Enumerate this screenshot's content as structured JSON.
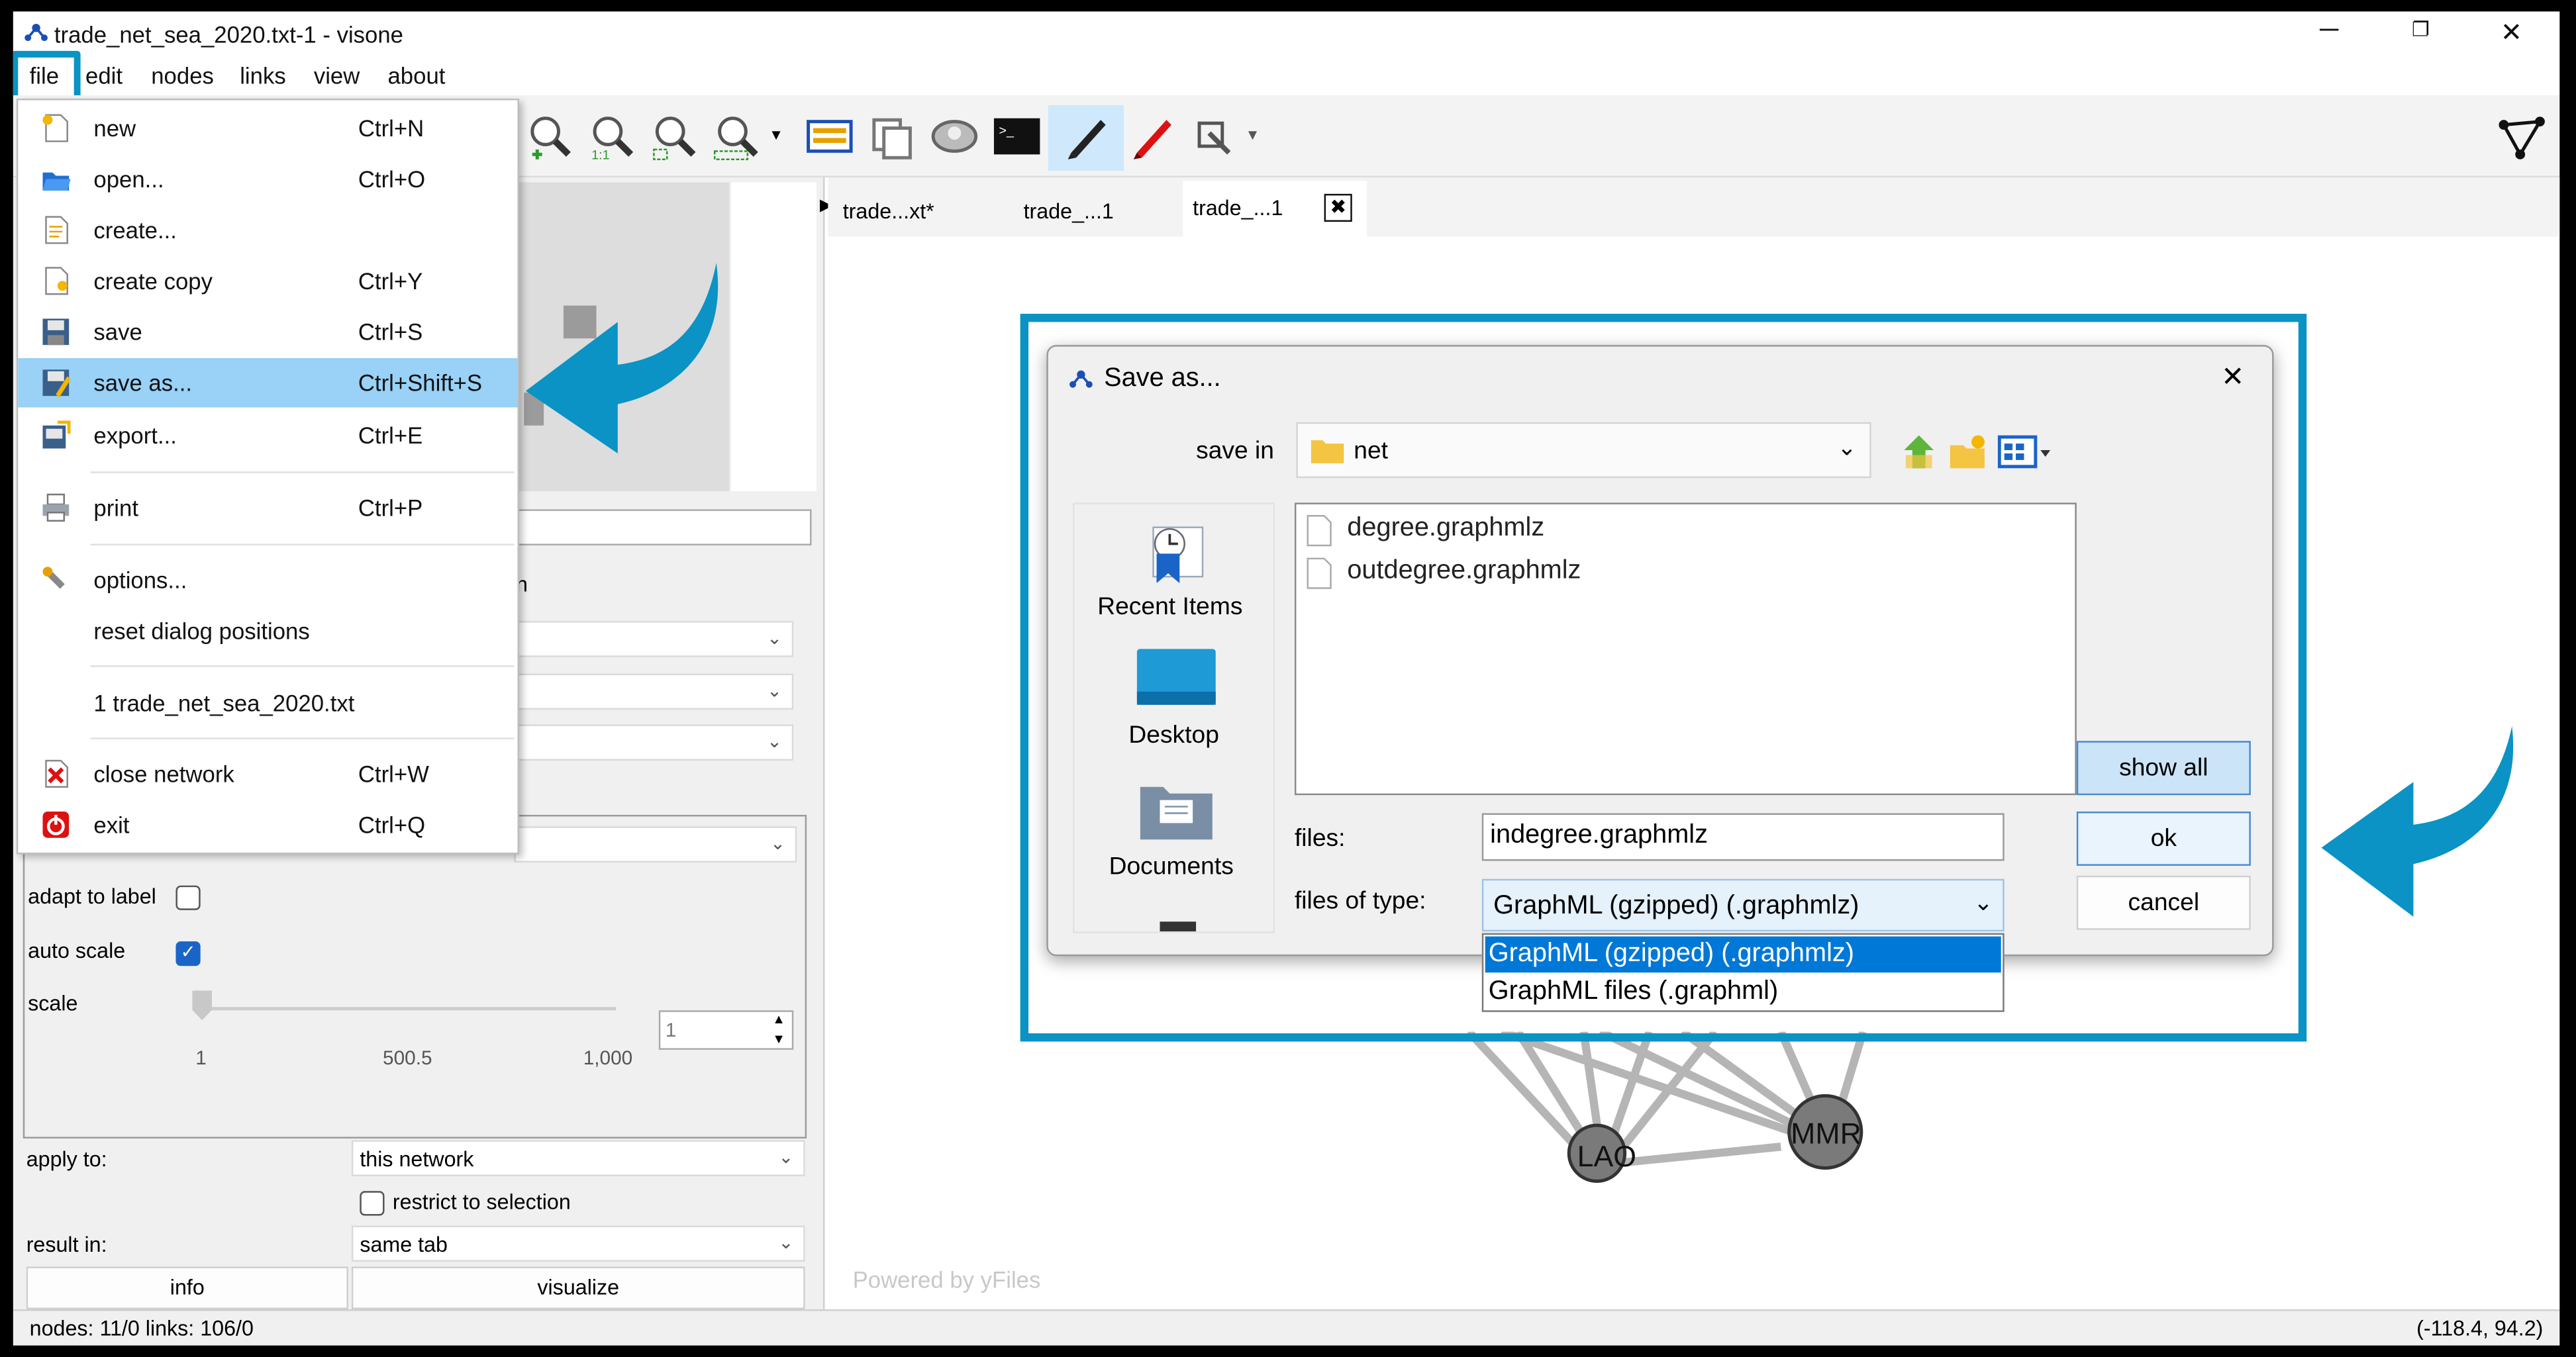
{
  "window": {
    "title": "trade_net_sea_2020.txt-1 - visone"
  },
  "menubar": [
    "file",
    "edit",
    "nodes",
    "links",
    "view",
    "about"
  ],
  "file_menu": [
    {
      "label": "new",
      "shortcut": "Ctrl+N",
      "icon": "new-doc-icon"
    },
    {
      "label": "open...",
      "shortcut": "Ctrl+O",
      "icon": "open-folder-icon"
    },
    {
      "label": "create...",
      "shortcut": "",
      "icon": "create-doc-icon"
    },
    {
      "label": "create copy",
      "shortcut": "Ctrl+Y",
      "icon": "copy-doc-icon"
    },
    {
      "label": "save",
      "shortcut": "Ctrl+S",
      "icon": "floppy-icon"
    },
    {
      "label": "save as...",
      "shortcut": "Ctrl+Shift+S",
      "icon": "save-as-icon"
    },
    {
      "label": "export...",
      "shortcut": "Ctrl+E",
      "icon": "export-icon"
    },
    {
      "label": "print",
      "shortcut": "Ctrl+P",
      "icon": "printer-icon"
    },
    {
      "label": "options...",
      "shortcut": "",
      "icon": "wrench-icon"
    },
    {
      "label": "reset dialog positions",
      "shortcut": "",
      "icon": ""
    },
    {
      "label": "1 trade_net_sea_2020.txt",
      "shortcut": "",
      "icon": ""
    },
    {
      "label": "close network",
      "shortcut": "Ctrl+W",
      "icon": "close-network-icon"
    },
    {
      "label": "exit",
      "shortcut": "Ctrl+Q",
      "icon": "power-icon"
    }
  ],
  "tabs": [
    "trade...xt*",
    "trade_...1",
    "trade_...1"
  ],
  "left_panel": {
    "adapt_to_label": "adapt to label",
    "auto_scale": "auto scale",
    "scale": "scale",
    "slider_ticks": [
      "1",
      "500.5",
      "1,000"
    ],
    "scale_value": "1",
    "apply_to_label": "apply to:",
    "apply_to_value": "this network",
    "restrict_label": "restrict to selection",
    "result_in_label": "result in:",
    "result_in_value": "same tab",
    "info_button": "info",
    "visualize_button": "visualize",
    "partial_label": "n"
  },
  "canvas": {
    "powered_by": "Powered by yFiles",
    "nodes": [
      "LAO",
      "MMR"
    ]
  },
  "status": {
    "left": "nodes: 11/0  links: 106/0",
    "right": "(-118.4, 94.2)"
  },
  "dialog": {
    "title": "Save as...",
    "save_in_label": "save in",
    "save_in_value": "net",
    "places": [
      "Recent Items",
      "Desktop",
      "Documents"
    ],
    "files": [
      "degree.graphmlz",
      "outdegree.graphmlz"
    ],
    "files_label": "files:",
    "files_value": "indegree.graphmlz",
    "type_label": "files of type:",
    "type_value": "GraphML (gzipped) (.graphmlz)",
    "type_options": [
      "GraphML (gzipped) (.graphmlz)",
      "GraphML files (.graphml)"
    ],
    "show_all": "show all",
    "ok": "ok",
    "cancel": "cancel"
  },
  "colors": {
    "accent": "#0a93c4",
    "highlight": "#99d1f7",
    "selected_option": "#0078d7"
  }
}
